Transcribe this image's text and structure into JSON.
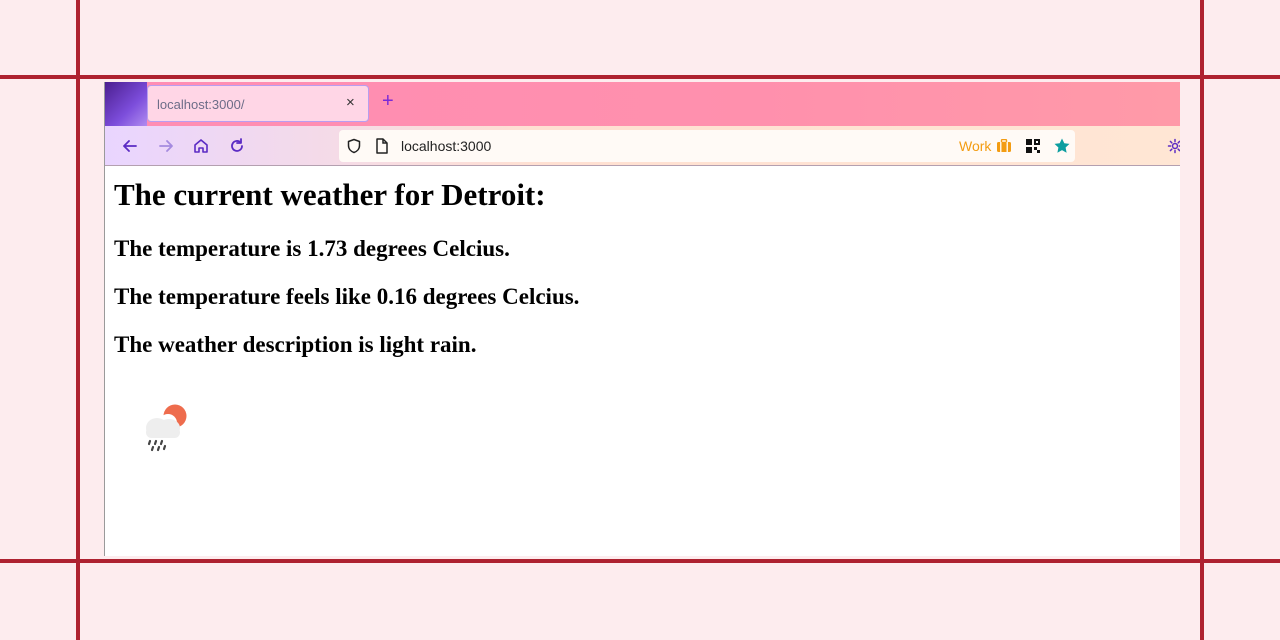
{
  "browser": {
    "tab_title": "localhost:3000/",
    "tab_close": "×",
    "new_tab": "+",
    "url": "localhost:3000",
    "container_label": "Work"
  },
  "page": {
    "heading": "The current weather for Detroit:",
    "temperature_line": "The temperature is 1.73 degrees Celcius.",
    "feels_like_line": "The temperature feels like 0.16 degrees Celcius.",
    "description_line": "The weather description is light rain.",
    "weather_icon": "light-rain-cloud-sun-icon"
  },
  "colors": {
    "frame_line": "#ae2230",
    "background": "#fdecee",
    "tab_accent": "#7a2ad8",
    "work_label": "#f39c12"
  }
}
